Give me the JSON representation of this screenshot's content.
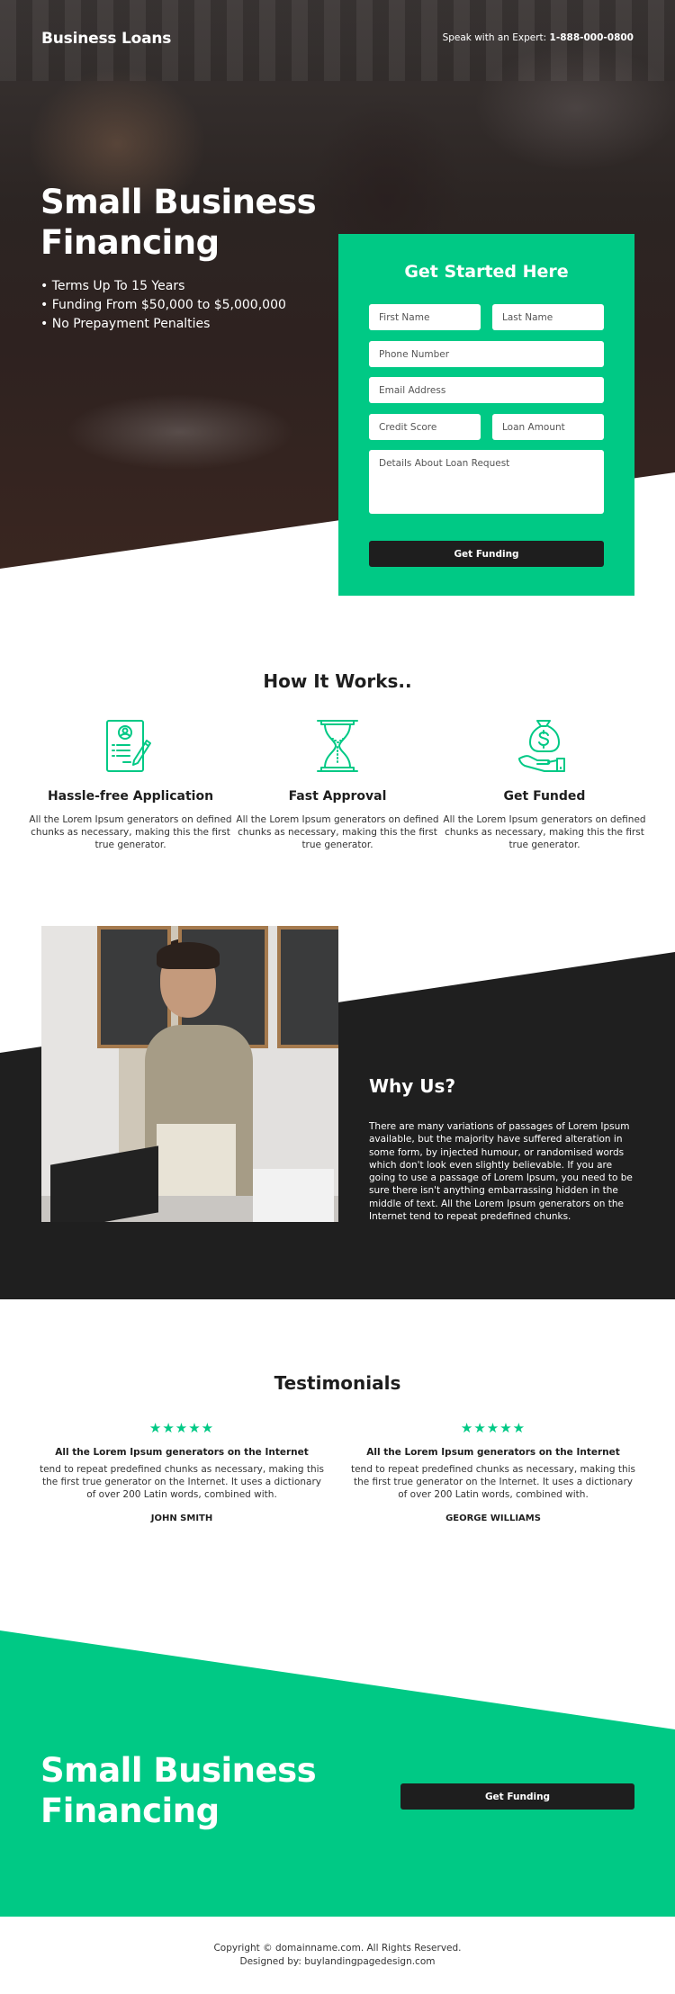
{
  "colors": {
    "accent": "#00c985",
    "dark": "#1f1f1f",
    "text": "#1e1e1e"
  },
  "header": {
    "brand": "Business Loans",
    "expert_label": "Speak with an Expert:",
    "phone": "1-888-000-0800"
  },
  "hero": {
    "title_line1": "Small Business",
    "title_line2": "Financing",
    "bullets": [
      "Terms Up To 15 Years",
      "Funding From $50,000 to $5,000,000",
      "No Prepayment Penalties"
    ]
  },
  "form": {
    "title": "Get Started Here",
    "fields": {
      "first_name": "First Name",
      "last_name": "Last Name",
      "phone": "Phone Number",
      "email": "Email Address",
      "credit_score": "Credit Score",
      "loan_amount": "Loan Amount",
      "details": "Details About Loan Request"
    },
    "submit_label": "Get Funding"
  },
  "how": {
    "title": "How It Works..",
    "steps": [
      {
        "icon": "application-form-icon",
        "title": "Hassle-free Application",
        "text": "All the Lorem Ipsum generators on defined chunks as necessary, making this the first true generator."
      },
      {
        "icon": "hourglass-icon",
        "title": "Fast Approval",
        "text": "All the Lorem Ipsum generators on defined chunks as necessary, making this the first true generator."
      },
      {
        "icon": "money-bag-hand-icon",
        "title": "Get Funded",
        "text": "All the Lorem Ipsum generators on defined chunks as necessary, making this the first true generator."
      }
    ]
  },
  "why": {
    "title": "Why Us?",
    "text": "There are many variations of passages of Lorem Ipsum available, but the majority have suffered alteration in some form, by injected humour, or randomised words which don't look even slightly believable. If you are going to use a passage of Lorem Ipsum, you need to be sure there isn't anything embarrassing hidden in the middle of text. All the Lorem Ipsum generators on the Internet tend to repeat predefined chunks."
  },
  "testimonials": {
    "title": "Testimonials",
    "items": [
      {
        "rating": 5,
        "stars": "★★★★★",
        "heading": "All the Lorem Ipsum generators on the Internet",
        "text": "tend to repeat predefined chunks as necessary, making this the first true generator on the Internet. It uses a dictionary of over 200 Latin words, combined with.",
        "author": "JOHN SMITH"
      },
      {
        "rating": 5,
        "stars": "★★★★★",
        "heading": "All the Lorem Ipsum generators on the Internet",
        "text": "tend to repeat predefined chunks as necessary, making this the first true generator on the Internet. It uses a dictionary of over 200 Latin words, combined with.",
        "author": "GEORGE WILLIAMS"
      }
    ]
  },
  "cta": {
    "title_line1": "Small Business",
    "title_line2": "Financing",
    "button_label": "Get Funding"
  },
  "footer": {
    "copyright": "Copyright © domainname.com. All Rights Reserved.",
    "designed_by": "Designed by: buylandingpagedesign.com"
  }
}
